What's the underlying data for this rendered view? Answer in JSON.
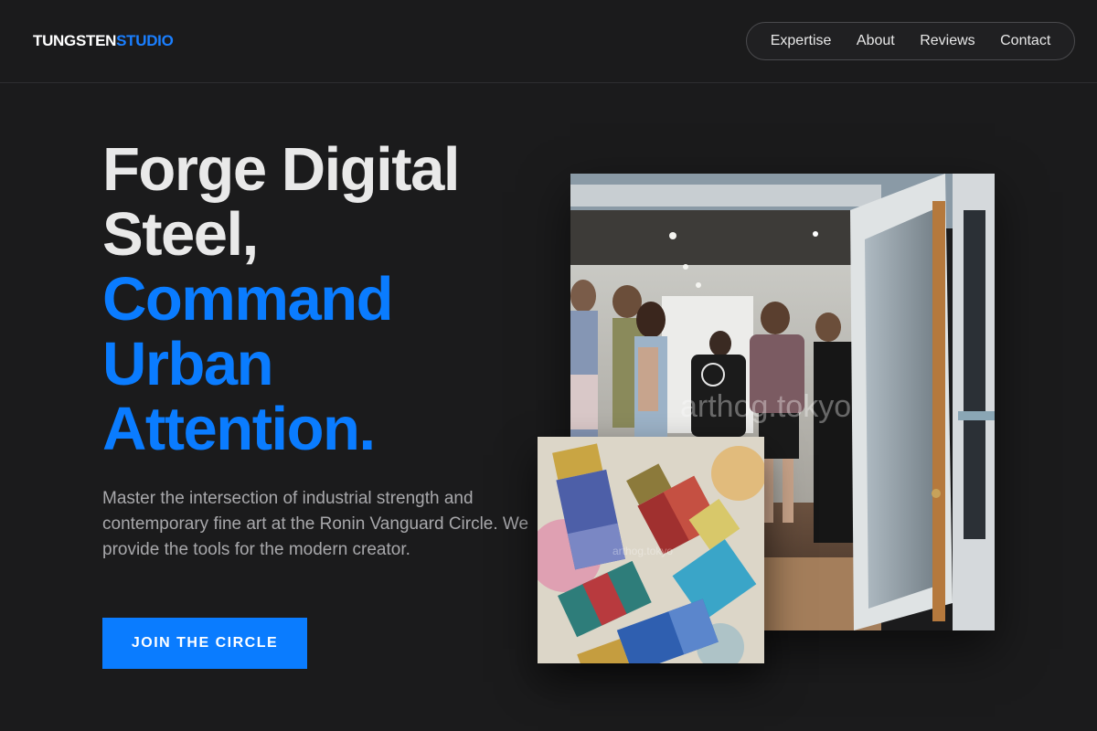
{
  "header": {
    "brand_primary": "TUNGSTEN",
    "brand_secondary": "STUDIO",
    "nav": [
      "Expertise",
      "About",
      "Reviews",
      "Contact"
    ]
  },
  "hero": {
    "headline_white_1": "Forge Digital",
    "headline_white_2": "Steel,",
    "headline_blue_1": "Command",
    "headline_blue_2": "Urban",
    "headline_blue_3": "Attention.",
    "subtext": "Master the intersection of industrial strength and contemporary fine art at the Ronin Vanguard Circle. We provide the tools for the modern creator.",
    "cta_label": "JOIN THE CIRCLE"
  },
  "images": {
    "gallery_watermark": "arthog.tokyo",
    "brushes_watermark": "arthog.tokyo"
  },
  "colors": {
    "background": "#1b1b1c",
    "accent": "#0a7cff",
    "text": "#e9e9e9",
    "muted": "#a8a8ab"
  }
}
